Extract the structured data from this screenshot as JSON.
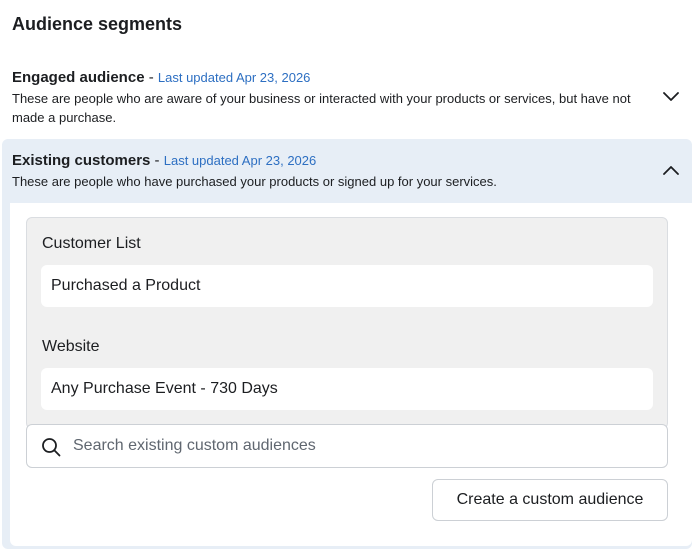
{
  "page": {
    "title": "Audience segments"
  },
  "segments": [
    {
      "name": "Engaged audience",
      "separator": " - ",
      "updated": "Last updated Apr 23, 2026",
      "description": "These are people who are aware of your business or interacted with your products or services, but have not made a purchase.",
      "expanded": false,
      "chevron_icon": "chevron-down-icon"
    },
    {
      "name": "Existing customers",
      "separator": " - ",
      "updated": "Last updated Apr 23, 2026",
      "description": "These are people who have purchased your products or signed up for your services.",
      "expanded": true,
      "chevron_icon": "chevron-up-icon",
      "groups": [
        {
          "label": "Customer List",
          "value": "Purchased a Product"
        },
        {
          "label": "Website",
          "value": "Any Purchase Event - 730 Days"
        }
      ],
      "search": {
        "placeholder": "Search existing custom audiences",
        "value": ""
      },
      "create_button_label": "Create a custom audience"
    }
  ],
  "colors": {
    "accent_text": "#2d6fc2",
    "expanded_bg": "#e7eef6",
    "list_bg": "#f0f0f0"
  }
}
